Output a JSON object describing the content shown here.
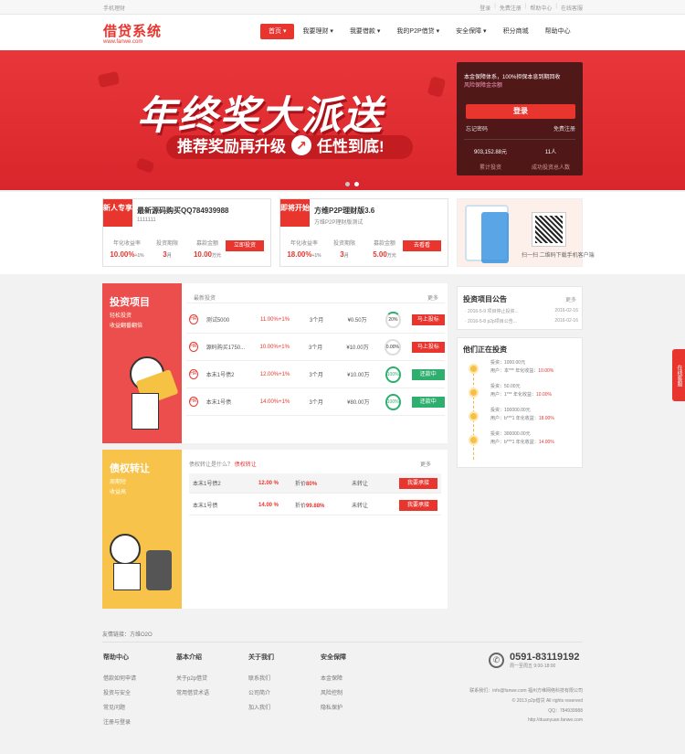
{
  "topbar": {
    "mobile": "手机理财",
    "links": [
      "登录",
      "免费注册",
      "帮助中心",
      "在线客服"
    ]
  },
  "logo": {
    "title": "借贷系统",
    "url": "www.fanwe.com"
  },
  "nav": [
    "首页",
    "我要理财",
    "我要借款",
    "我的P2P借贷",
    "安全保障",
    "积分商城",
    "帮助中心"
  ],
  "banner": {
    "headline": "年终奖大派送",
    "sub1": "推荐奖励再升级",
    "sub2": "任性到底!"
  },
  "login": {
    "text": "本金保障体系，100%担保本息到期回收",
    "sub": "风险保障金余额",
    "btn": "登录",
    "forgot": "忘记密码",
    "register": "免费注册",
    "stat1_val": "903,152.88元",
    "stat1_lbl": "累计投资",
    "stat2_val": "11人",
    "stat2_lbl": "成功投资总人数"
  },
  "products": [
    {
      "tag": "新人专享",
      "name": "最新源码购买QQ784939988",
      "sub": "1111111",
      "c1l": "年化收益率",
      "c1v": "10.00%",
      "c1x": "+1%",
      "c2l": "投资期限",
      "c2v": "3",
      "c2u": "月",
      "c3l": "募款金额",
      "c3v": "10.00",
      "c3u": "万元",
      "btn": "立即投资"
    },
    {
      "tag": "即将开始",
      "name": "方维P2P理财版3.6",
      "sub": "方维P2P理财版测试",
      "c1l": "年化收益率",
      "c1v": "18.00%",
      "c1x": "+1%",
      "c2l": "投资期限",
      "c2v": "3",
      "c2u": "月",
      "c3l": "募款金额",
      "c3v": "5.00",
      "c3u": "万元",
      "btn": "去看看"
    }
  ],
  "app": {
    "label": "扫一扫 二维码下载手机客户端"
  },
  "invest": {
    "title": "投资项目",
    "desc1": "轻松投资",
    "desc2": "收益翻番翻倍",
    "tab": "最新投资",
    "more": "更多",
    "rows": [
      {
        "name": "测试5000",
        "rate": "11.00%+1%",
        "term": "3个月",
        "amt": "¥0.50万",
        "prog": "20%",
        "btn": "马上投标",
        "state": "part"
      },
      {
        "name": "源码购买1750...",
        "rate": "10.00%+1%",
        "term": "3个月",
        "amt": "¥10.00万",
        "prog": "0.00%",
        "btn": "马上投标",
        "state": "none"
      },
      {
        "name": "本末1号债2",
        "rate": "12.00%+1%",
        "term": "3个月",
        "amt": "¥10.00万",
        "prog": "100%",
        "btn": "还款中",
        "state": "full"
      },
      {
        "name": "本末1号债",
        "rate": "14.00%+1%",
        "term": "3个月",
        "amt": "¥80.00万",
        "prog": "100%",
        "btn": "还款中",
        "state": "full"
      }
    ]
  },
  "transfer": {
    "title": "债权转让",
    "desc1": "周期短",
    "desc2": "收益高",
    "hdr": "债权转让是什么？",
    "hdr2": "债权转让",
    "more": "更多",
    "rows": [
      {
        "name": "本末1号债2",
        "rate": "12.00 %",
        "plabel": "折价",
        "pval": "80%",
        "state": "未转让",
        "btn": "我要承接"
      },
      {
        "name": "本末1号债",
        "rate": "14.00 %",
        "plabel": "折价",
        "pval": "99.88%",
        "state": "未转让",
        "btn": "我要承接"
      }
    ]
  },
  "notice": {
    "title": "投资项目公告",
    "more": "更多",
    "items": [
      {
        "t": "· 2016-5-9 项目停止投资...",
        "d": "2016-02-16"
      },
      {
        "t": "· 2016-5-8 p2p项目公告...",
        "d": "2016-02-16"
      }
    ]
  },
  "recent": {
    "title": "他们正在投资",
    "items": [
      {
        "l1": "投资：1000.00元",
        "l2a": "用户：本***",
        "l2b": "年化收益：",
        "l2c": "10.00%"
      },
      {
        "l1": "投资：50.00元",
        "l2a": "用户：1***",
        "l2b": "年化收益：",
        "l2c": "10.00%"
      },
      {
        "l1": "投资：100000.00元",
        "l2a": "用户：b***1",
        "l2b": "年化收益：",
        "l2c": "18.00%"
      },
      {
        "l1": "投资：300000.00元",
        "l2a": "用户：b***1",
        "l2b": "年化收益：",
        "l2c": "14.00%"
      }
    ]
  },
  "sidetab": "在线客服",
  "footer": {
    "links_title": "友情链接：",
    "links_val": "方维O2O",
    "cols": [
      {
        "h": "帮助中心",
        "items": [
          "借款如何申请",
          "投资与安全",
          "常见问题",
          "注册与登录"
        ]
      },
      {
        "h": "基本介绍",
        "items": [
          "关于p2p借贷",
          "常用借贷术语"
        ]
      },
      {
        "h": "关于我们",
        "items": [
          "联系我们",
          "公司简介",
          "加入我们"
        ]
      },
      {
        "h": "安全保障",
        "items": [
          "本金保障",
          "风险控制",
          "隐私保护"
        ]
      }
    ],
    "phone": "0591-83119192",
    "hours": "周一至周五 9:00-18:00",
    "contact": "联系我们：info@fanwe.com  福州方维网络科技有限公司",
    "copy": "© 2013 p2p借贷 All rights reserved",
    "qq": "QQ：784939988",
    "site": "http://duanyuan.fanwe.com"
  }
}
